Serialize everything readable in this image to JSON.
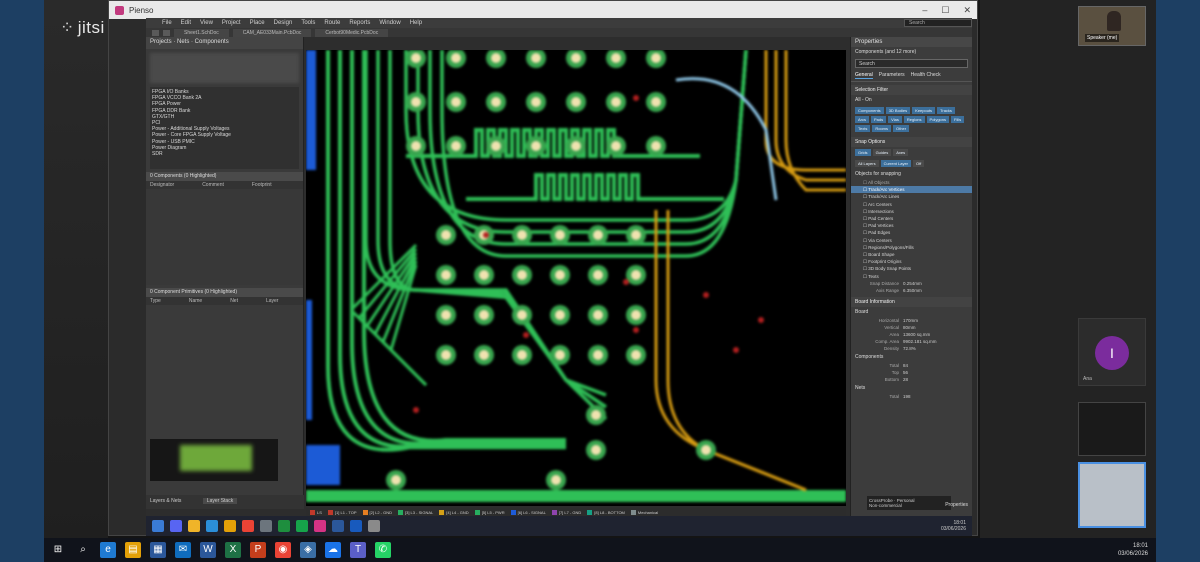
{
  "jitsi": {
    "logo": "jitsi"
  },
  "window": {
    "title": "Pienso",
    "controls": [
      "–",
      "☐",
      "✕"
    ]
  },
  "menu": [
    "File",
    "Edit",
    "View",
    "Project",
    "Place",
    "Design",
    "Tools",
    "Route",
    "Reports",
    "Window",
    "Help"
  ],
  "search_placeholder": "Search",
  "doc_tabs": [
    "Sheet1.SchDoc",
    "CAM_AE033Main.PcbDoc",
    "Cerbot90Medic.PcbDoc"
  ],
  "left_panel": {
    "title": "Projects · Nets · Components",
    "list": [
      "FPGA I/O Banks",
      "FPGA VCCO Bank 2A",
      "FPGA Power",
      "FPGA DDR Bank",
      "GTX/GTH",
      "PCI",
      "Power - Additional Supply Voltages",
      "Power - Core FPGA Supply Voltage",
      "Power - USB PMIC",
      "Power Diagram",
      "SDR"
    ],
    "section1": "0 Components (0 Highlighted)",
    "cols1": [
      "Designator",
      "Comment",
      "Footprint"
    ],
    "section2": "0 Component Primitives (0 Highlighted)",
    "cols2": [
      "Type",
      "Name",
      "Net",
      "Layer"
    ],
    "footer": "Layers & Nets",
    "footer_button": "Layer Stack"
  },
  "layers": [
    {
      "name": "LS",
      "color": "#c0392b"
    },
    {
      "name": "[1] L1 - TOP",
      "color": "#c0392b"
    },
    {
      "name": "[2] L2 - GND",
      "color": "#e67e22"
    },
    {
      "name": "[3] L3 - SIGNAL",
      "color": "#27ae60"
    },
    {
      "name": "[4] L4 - GND",
      "color": "#d4a017"
    },
    {
      "name": "[5] L5 - PWR",
      "color": "#27ae60"
    },
    {
      "name": "[6] L6 - SIGNAL",
      "color": "#1e5bd8"
    },
    {
      "name": "[7] L7 - GND",
      "color": "#8e44ad"
    },
    {
      "name": "[8] L8 - BOTTOM",
      "color": "#16a085"
    },
    {
      "name": "Mechanical",
      "color": "#7f8c8d"
    }
  ],
  "right_panel": {
    "title": "Properties",
    "filter_label": "Components (and 12 more)",
    "search": "Search",
    "tabs": [
      "General",
      "Parameters",
      "Health Check"
    ],
    "selection_filter": "Selection Filter",
    "filter_all": "All - On",
    "chips": [
      "Components",
      "3D Bodies",
      "Keepouts",
      "Tracks",
      "Arcs",
      "Pads",
      "Vias",
      "Regions",
      "Polygons",
      "Fills",
      "Texts",
      "Rooms",
      "Other"
    ],
    "snap_options": "Snap Options",
    "snap_tabs": [
      "Grids",
      "Guides",
      "Axes"
    ],
    "snap_layers": [
      "All Layers",
      "Current Layer",
      "Off"
    ],
    "snapping": "Snapping",
    "snap_value": "Snap Distance",
    "objects_header": "Objects for snapping",
    "tree": [
      "All Objects",
      "Track/Arc Vertices",
      "Track/Arc Lines",
      "Arc Centers",
      "Intersections",
      "Pad Centers",
      "Pad Vertices",
      "Pad Edges",
      "Via Centers",
      "Regions/Polygons/Fills",
      "Board Shape",
      "Footprint Origins",
      "3D Body Snap Points",
      "Texts"
    ],
    "snap_distance_label": "Snap Distance",
    "snap_distance_value": "0.254mm",
    "axis_label": "Axis Range",
    "axis_value": "6.350mm",
    "info_header": "Board Information",
    "board_header": "Board",
    "kv": [
      [
        "Horizontal",
        "170mm"
      ],
      [
        "Vertical",
        "80mm"
      ],
      [
        "Area",
        "13600 sq.mm"
      ],
      [
        "Comp. Area",
        "9902.181 sq.mm"
      ],
      [
        "Density",
        "72.8%"
      ]
    ],
    "comp_header": "Components",
    "comp_kv": [
      [
        "Total",
        "84"
      ],
      [
        "Top",
        "56"
      ],
      [
        "Bottom",
        "28"
      ]
    ],
    "nets_header": "Nets",
    "nets_kv": [
      [
        "Total",
        "198"
      ]
    ],
    "status_line1": "CrossProbe · Personal",
    "status_line2": "Non-commercial",
    "status_btn": "Properties"
  },
  "inner_taskbar": {
    "icons": [
      "win",
      "chat",
      "explorer",
      "edge",
      "folder",
      "chrome",
      "files",
      "sheets",
      "green",
      "altium",
      "docs",
      "word",
      "settings"
    ],
    "time": "18:01",
    "date": "03/06/2026"
  },
  "participants": {
    "me": "Speaker (me)",
    "avatar_initial": "I",
    "avatar_label": "Ana"
  },
  "taskbar": {
    "icons": [
      "windows-icon",
      "search-icon",
      "edge-icon",
      "explorer-icon",
      "calculator-icon",
      "outlook-icon",
      "word-icon",
      "excel-icon",
      "powerpoint-icon",
      "chrome-icon",
      "vpn-icon",
      "onedrive-icon",
      "teams-icon",
      "whatsapp-icon"
    ],
    "time": "18:01",
    "date": "03/06/2026"
  },
  "colors": {
    "board_green": "#2fbf57",
    "trace_blue": "#1c5bd6",
    "trace_orange": "#d49a12",
    "pad_ring": "#38a54e",
    "pad_core": "#f0e2b0",
    "via_red": "#b21f1f"
  }
}
